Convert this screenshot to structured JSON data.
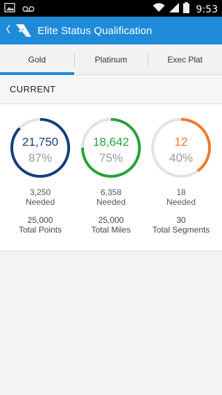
{
  "status_bar": {
    "time": "9:53",
    "icons": [
      "image-icon",
      "voicemail-icon",
      "wifi-icon",
      "signal-icon",
      "battery-icon"
    ]
  },
  "app_bar": {
    "title": "Elite Status Qualification",
    "back_icon": "chevron-left-icon",
    "logo": "airline-logo-icon"
  },
  "tabs": [
    {
      "label": "Gold",
      "active": true
    },
    {
      "label": "Platinum",
      "active": false
    },
    {
      "label": "Exec Plat",
      "active": false
    }
  ],
  "section": {
    "title": "CURRENT"
  },
  "colors": {
    "accent": "#1f8bd8",
    "points": "#123f7a",
    "miles": "#25a33a",
    "segments": "#ef7a2e",
    "track": "#e3e3e3"
  },
  "metrics": [
    {
      "value": "21,750",
      "percent_label": "87%",
      "progress": 0.87,
      "needed_value": "3,250",
      "needed_label": "Needed",
      "total_value": "25,000",
      "total_label": "Total Points"
    },
    {
      "value": "18,642",
      "percent_label": "75%",
      "progress": 0.75,
      "needed_value": "6,358",
      "needed_label": "Needed",
      "total_value": "25,000",
      "total_label": "Total Miles"
    },
    {
      "value": "12",
      "percent_label": "40%",
      "progress": 0.4,
      "needed_value": "18",
      "needed_label": "Needed",
      "total_value": "30",
      "total_label": "Total Segments"
    }
  ]
}
